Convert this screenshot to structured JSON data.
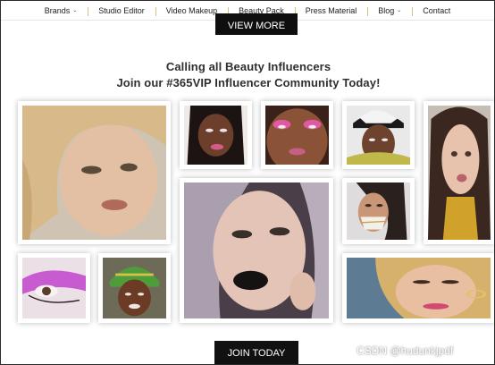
{
  "nav": {
    "items": [
      {
        "label": "Brands",
        "has_caret": true
      },
      {
        "label": "Studio Editor",
        "has_caret": false
      },
      {
        "label": "Video Makeup",
        "has_caret": false
      },
      {
        "label": "Beauty Pack",
        "has_caret": false
      },
      {
        "label": "Press Material",
        "has_caret": false
      },
      {
        "label": "Blog",
        "has_caret": true
      },
      {
        "label": "Contact",
        "has_caret": false
      }
    ],
    "caret_glyph": "⌄"
  },
  "view_more_label": "VIEW MORE",
  "headline": {
    "line1": "Calling all Beauty Influencers",
    "line2": "Join our #365VIP Influencer Community Today!"
  },
  "gallery": {
    "photos": [
      {
        "name": "photo-blonde-influencer"
      },
      {
        "name": "photo-pink-lip-portrait"
      },
      {
        "name": "photo-pink-eyeshadow"
      },
      {
        "name": "photo-snapback-cap"
      },
      {
        "name": "photo-long-dark-hair"
      },
      {
        "name": "photo-black-lipstick"
      },
      {
        "name": "photo-gold-face-art"
      },
      {
        "name": "photo-pink-eye-closeup"
      },
      {
        "name": "photo-green-headwrap"
      },
      {
        "name": "photo-blonde-closeup"
      }
    ]
  },
  "join_label": "JOIN TODAY",
  "watermark": "CSDN @hudunkjpdf",
  "colors": {
    "button_bg": "#0f0f0f",
    "nav_divider": "#d9c27a",
    "headline": "#2f2f2f"
  }
}
